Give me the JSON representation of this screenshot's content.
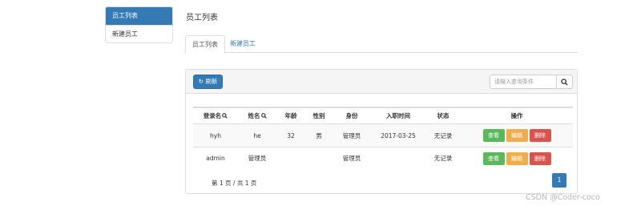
{
  "sidebar": {
    "items": [
      {
        "label": "员工列表",
        "active": true
      },
      {
        "label": "新建员工",
        "active": false
      }
    ]
  },
  "page_title": "员工列表",
  "tabs": [
    {
      "label": "员工列表",
      "active": true
    },
    {
      "label": "新建员工",
      "active": false
    }
  ],
  "toolbar": {
    "refresh_label": "刷新",
    "search_placeholder": "请输入查询条件"
  },
  "table": {
    "headers": [
      "登录名",
      "姓名",
      "年龄",
      "性别",
      "身份",
      "入职时间",
      "状态",
      "操作"
    ],
    "rows": [
      {
        "login": "hyh",
        "name": "he",
        "age": "32",
        "gender": "男",
        "role": "管理员",
        "hire_date": "2017-03-25",
        "status": "无记录"
      },
      {
        "login": "admin",
        "name": "管理员",
        "age": "",
        "gender": "",
        "role": "管理员",
        "hire_date": "",
        "status": "无记录"
      }
    ],
    "actions": {
      "view": "查看",
      "edit": "编辑",
      "delete": "删除"
    }
  },
  "pagination": {
    "info": "第 1 页 / 共 1 页",
    "current_page": "1"
  },
  "watermark": "CSDN @Coder-coco",
  "colors": {
    "primary": "#337ab7",
    "success": "#5cb85c",
    "warning": "#f0ad4e",
    "danger": "#d9534f"
  }
}
